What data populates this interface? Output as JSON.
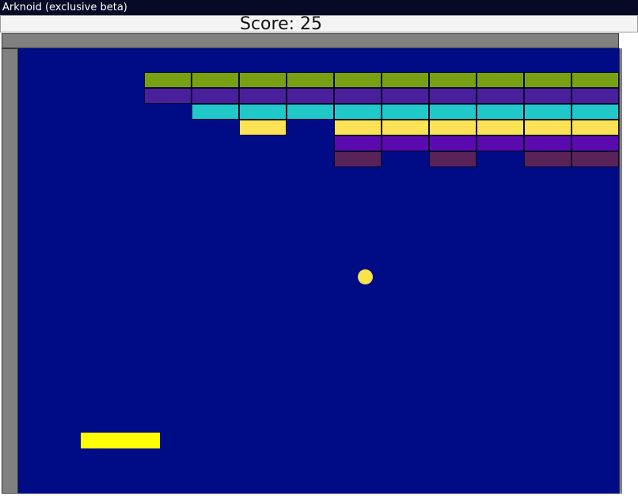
{
  "window": {
    "title": "Arknoid (exclusive beta)"
  },
  "hud": {
    "score_text": "Score: 25"
  },
  "colors": {
    "playfield": "#000c86",
    "wall": "#808080",
    "ball": "#f7e24a",
    "paddle": "#ffff00",
    "green": "#77a113",
    "indigo": "#4a1f9b",
    "cyan": "#20c8c8",
    "yellow": "#fde255",
    "violet": "#5a0aae",
    "plum": "#5a2358"
  },
  "bricks": {
    "rows": [
      {
        "color": "green",
        "cells": [
          0,
          0,
          0,
          1,
          1,
          1,
          1,
          1,
          1,
          1,
          1,
          1,
          1
        ]
      },
      {
        "color": "indigo",
        "cells": [
          0,
          0,
          0,
          1,
          1,
          1,
          1,
          1,
          1,
          1,
          1,
          1,
          1
        ]
      },
      {
        "color": "cyan",
        "cells": [
          0,
          0,
          0,
          0,
          1,
          1,
          1,
          1,
          1,
          1,
          1,
          1,
          1
        ]
      },
      {
        "color": "yellow",
        "cells": [
          0,
          0,
          0,
          0,
          0,
          1,
          0,
          1,
          1,
          1,
          1,
          1,
          1
        ]
      },
      {
        "color": "violet",
        "cells": [
          0,
          0,
          0,
          0,
          0,
          0,
          0,
          1,
          1,
          1,
          1,
          1,
          1
        ]
      },
      {
        "color": "plum",
        "cells": [
          0,
          0,
          0,
          0,
          0,
          0,
          0,
          1,
          0,
          1,
          0,
          1,
          1
        ]
      }
    ]
  }
}
